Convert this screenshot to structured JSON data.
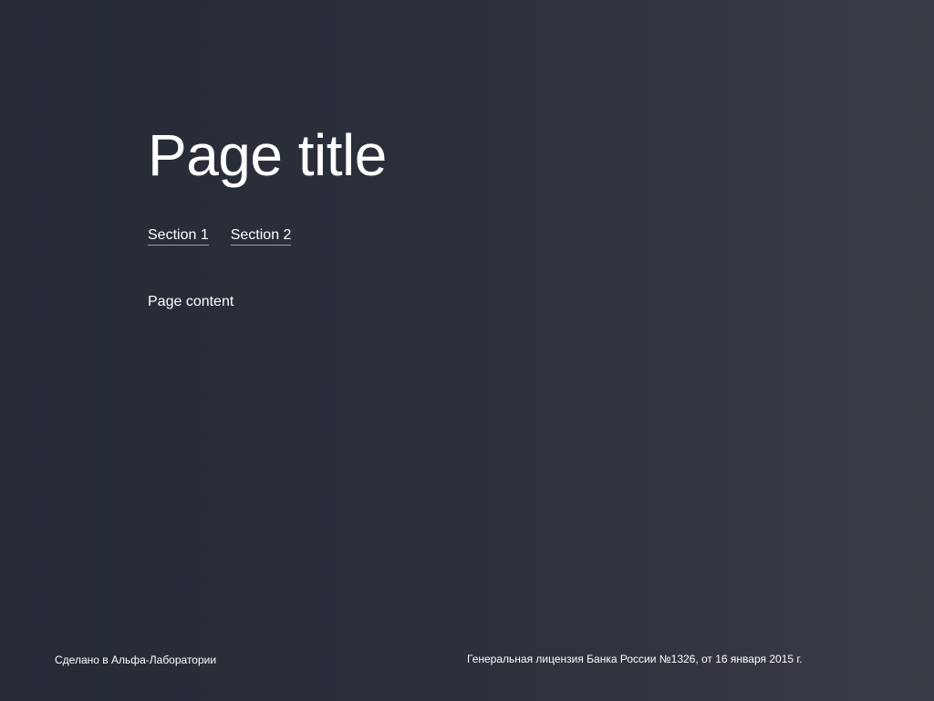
{
  "header": {
    "title": "Page title"
  },
  "tabs": [
    {
      "label": "Section 1"
    },
    {
      "label": "Section 2"
    }
  ],
  "main": {
    "content": "Page content"
  },
  "footer": {
    "left_text": "Сделано в Альфа-Лаборатории",
    "right_text": "Генеральная лицензия Банка России №1326, от 16 января 2015 г."
  },
  "colors": {
    "background_start": "#252a35",
    "background_end": "#3a3c47",
    "text": "#ffffff"
  }
}
